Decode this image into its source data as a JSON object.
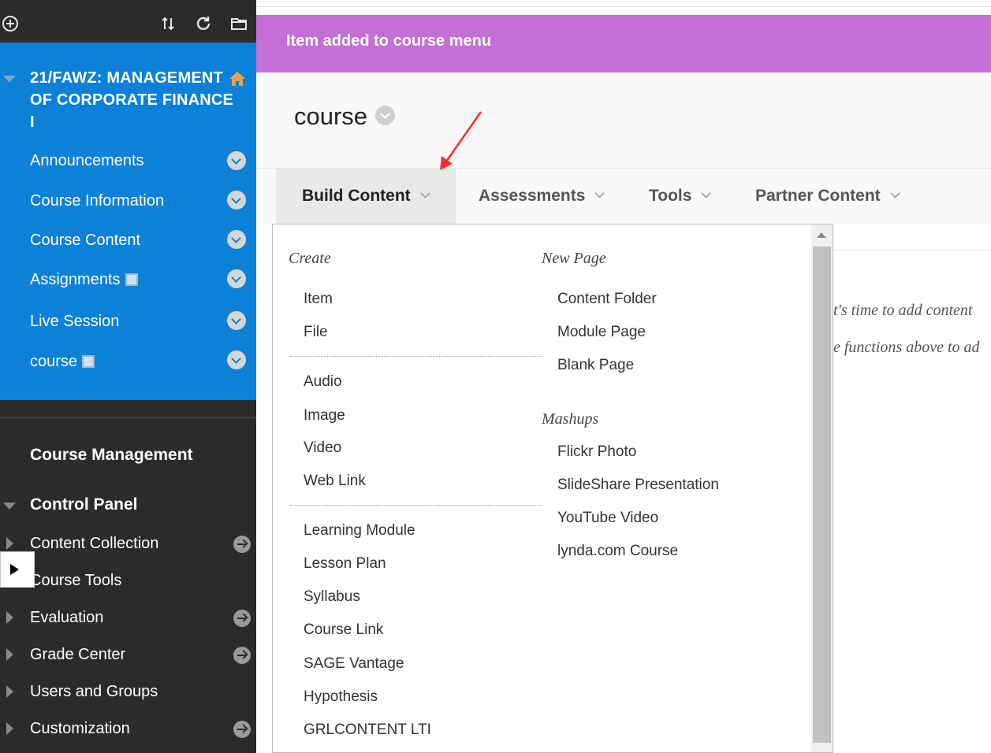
{
  "sidebar": {
    "toolbar_icons": [
      "add-menu-item-icon",
      "reorder-icon",
      "refresh-icon",
      "folder-view-icon"
    ],
    "course_title": "21/FAWZ: MANAGEMENT OF CORPORATE FINANCE I",
    "course_menu": [
      {
        "label": "Announcements"
      },
      {
        "label": "Course Information"
      },
      {
        "label": "Course Content"
      },
      {
        "label": "Assignments",
        "hidden_badge": true
      },
      {
        "label": "Live Session"
      },
      {
        "label": "course",
        "hidden_badge": true
      }
    ],
    "management_title": "Course Management",
    "control_panel_title": "Control Panel",
    "control_panel_items": [
      {
        "label": "Content Collection",
        "has_arrow": true
      },
      {
        "label": "Course Tools",
        "has_arrow": false
      },
      {
        "label": "Evaluation",
        "has_arrow": true
      },
      {
        "label": "Grade Center",
        "has_arrow": true
      },
      {
        "label": "Users and Groups",
        "has_arrow": false
      },
      {
        "label": "Customization",
        "has_arrow": true
      }
    ]
  },
  "notice": {
    "text": "Item added to course menu",
    "color": "#c36fd4"
  },
  "page": {
    "title": "course"
  },
  "action_bar": {
    "build_content": "Build Content",
    "assessments": "Assessments",
    "tools": "Tools",
    "partner_content": "Partner Content"
  },
  "background_text": {
    "line1": "t's time to add content",
    "line2": "e functions above to ad"
  },
  "dropdown": {
    "create_heading": "Create",
    "create_group1": [
      "Item",
      "File"
    ],
    "create_group2": [
      "Audio",
      "Image",
      "Video",
      "Web Link"
    ],
    "create_group3": [
      "Learning Module",
      "Lesson Plan",
      "Syllabus",
      "Course Link",
      "SAGE Vantage",
      "Hypothesis",
      "GRLCONTENT LTI"
    ],
    "new_page_heading": "New Page",
    "new_page_items": [
      "Content Folder",
      "Module Page",
      "Blank Page"
    ],
    "mashups_heading": "Mashups",
    "mashups_items": [
      "Flickr Photo",
      "SlideShare Presentation",
      "YouTube Video",
      "lynda.com Course"
    ]
  },
  "colors": {
    "sidebar_blue": "#0d80d8",
    "sidebar_dark": "#2b2b2b",
    "annotation_arrow": "#ff2a2a"
  }
}
